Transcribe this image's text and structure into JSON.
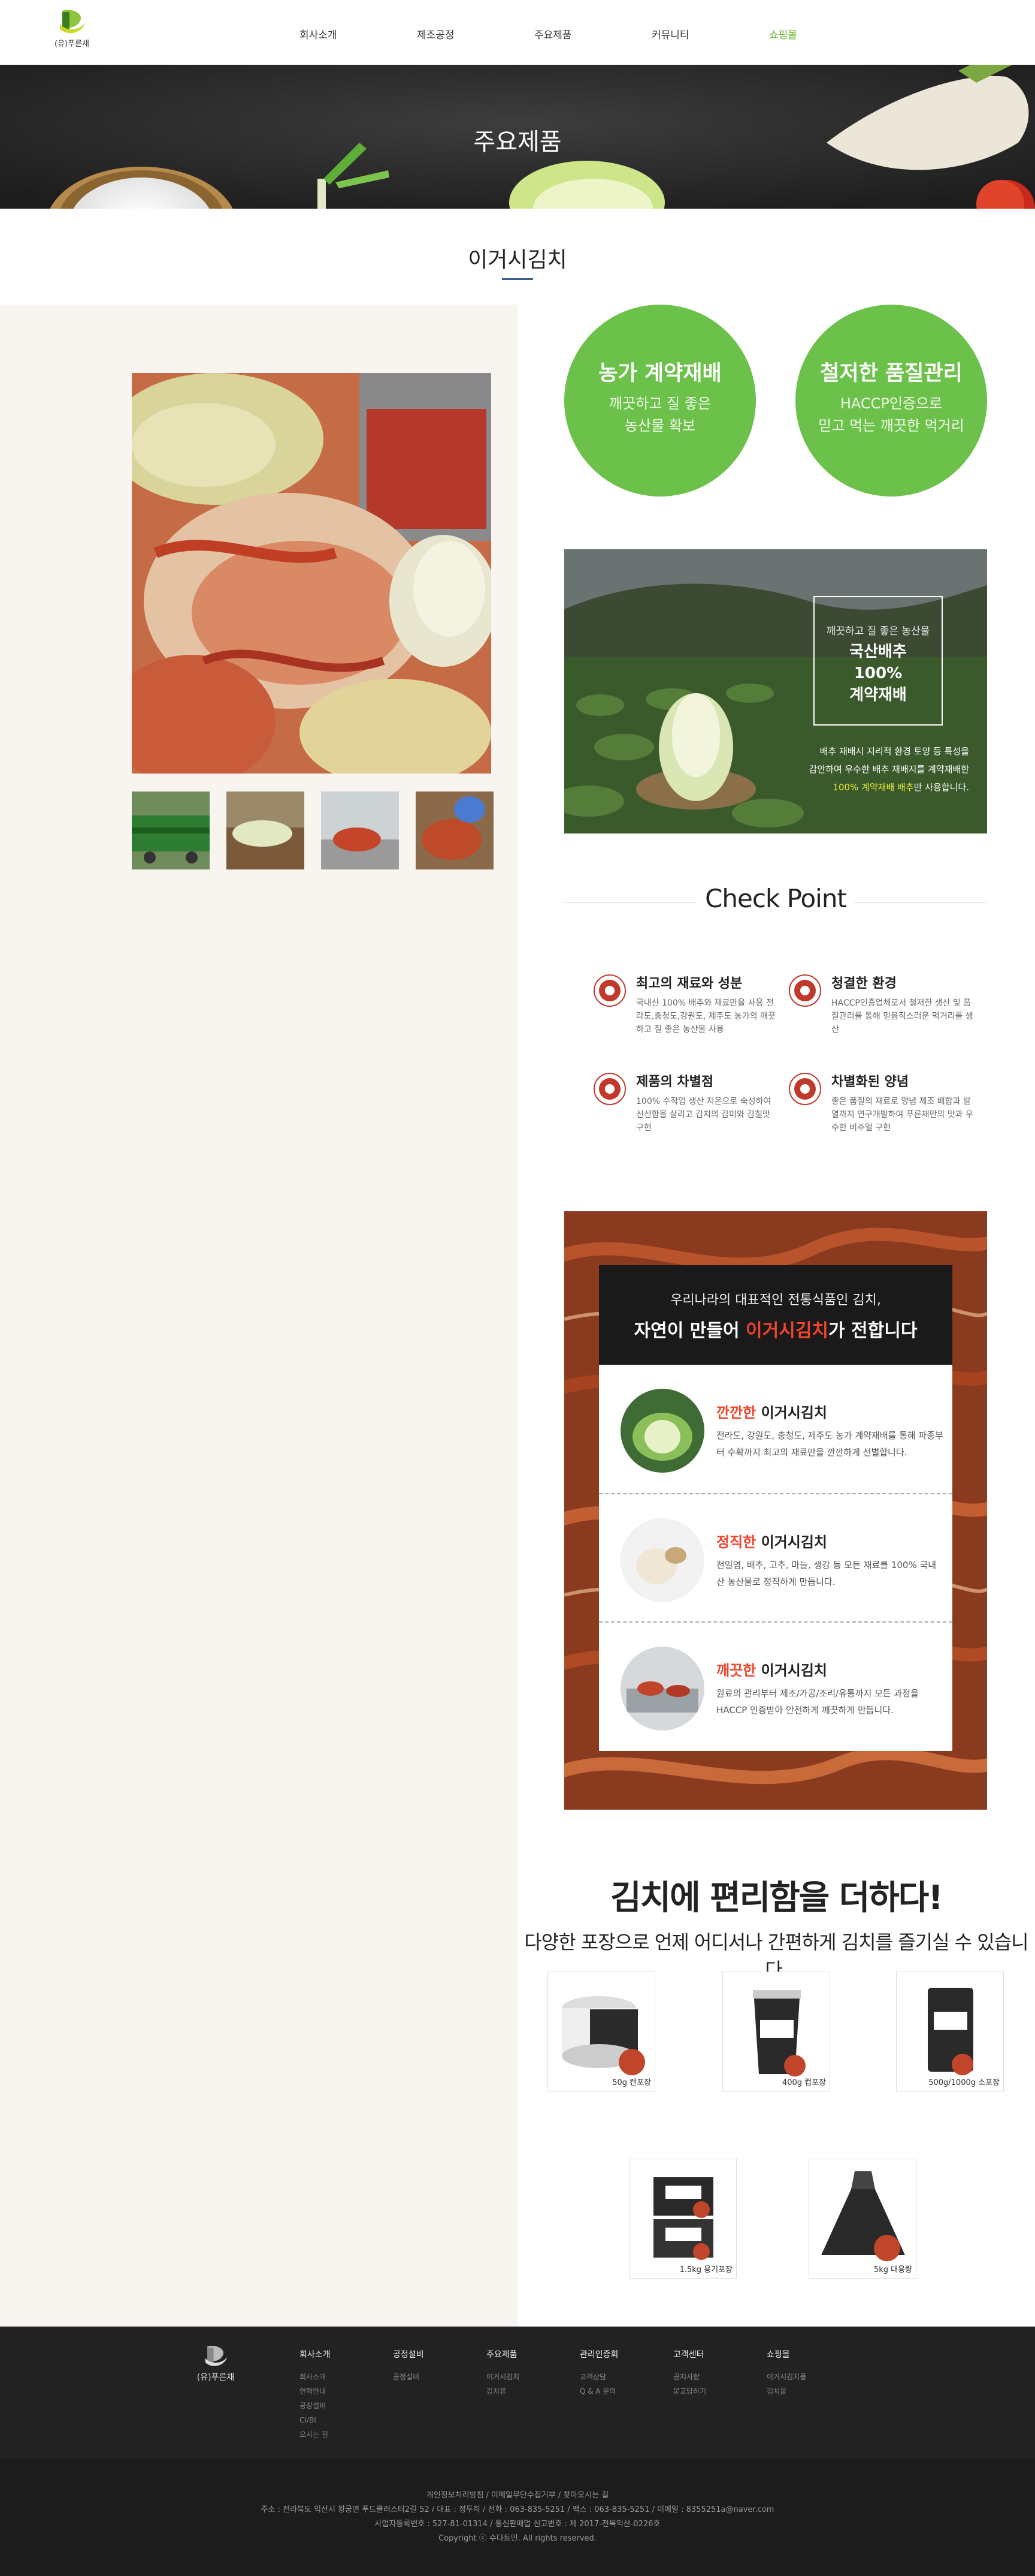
{
  "header": {
    "logo_text": "(유)푸른채",
    "nav": [
      {
        "label": "회사소개",
        "active": false
      },
      {
        "label": "제조공정",
        "active": false
      },
      {
        "label": "주요제품",
        "active": false
      },
      {
        "label": "커뮤니티",
        "active": false
      },
      {
        "label": "쇼핑몰",
        "active": true
      }
    ]
  },
  "banner": {
    "title": "주요제품"
  },
  "page": {
    "subtitle": "이거시김치"
  },
  "colors": {
    "accent": "#67b22a",
    "circle": "#6cc14a",
    "highlight": "#f0442c"
  },
  "features": [
    {
      "title": "농가 계약재배",
      "lines": [
        "깨끗하고 질 좋은",
        "농산물 확보"
      ]
    },
    {
      "title": "철저한 품질관리",
      "lines": [
        "HACCP인증으로",
        "믿고 먹는 깨끗한 먹거리"
      ]
    }
  ],
  "field": {
    "box_small": "깨끗하고 질 좋은 농산물",
    "box_lines": [
      "국산배추",
      "100%",
      "계약재배"
    ],
    "caption_lines": [
      "배추 재배시 지리적 환경 토양 등 특성을",
      "감안하여 우수한 배추 재배지를 계약재배한"
    ],
    "caption_highlight": "100% 계약재배 배추",
    "caption_tail": "만 사용합니다."
  },
  "check_point": {
    "title": "Check Point",
    "items": [
      {
        "title": "최고의 재료와 성분",
        "text": "국내산 100% 배추와 재료만을 사용 전라도,충청도,강원도, 제주도 농가의 깨끗하고 질 좋은 농산물 사용"
      },
      {
        "title": "청결한 환경",
        "text": "HACCP인증업체로서 철저한 생산 및 품질관리를 통해 믿음직스러운 먹거리를 생산"
      },
      {
        "title": "제품의 차별점",
        "text": "100% 수작업 생산 저온으로 숙성하여 신선함을 살리고 김치의 감미와 감칠맛 구현"
      },
      {
        "title": "차별화된 양념",
        "text": "좋은 품질의 재료로 양념 제조 배합과 발열까지 연구개발하여 푸른채만의 맛과 우수한 비주얼 구현"
      }
    ]
  },
  "kimchi_box": {
    "line1": "우리나라의 대표적인 전통식품인 김치,",
    "line2_pre": "자연이 만들어 ",
    "line2_hl": "이거시김치",
    "line2_post": "가 전합니다",
    "rows": [
      {
        "hl": "깐깐한",
        "title": " 이거시김치",
        "desc": "전라도, 강원도, 충청도, 제주도 농가 계약재배를 통해 파종부터 수확까지 최고의 재료만을 깐깐하게 선별합니다."
      },
      {
        "hl": "정직한",
        "title": " 이거시김치",
        "desc": "천일염, 배추, 고추, 마늘, 생강 등 모든 재료를 100% 국내산 농산물로 정직하게 만듭니다."
      },
      {
        "hl": "깨끗한",
        "title": " 이거시김치",
        "desc": "원료의 관리부터 제조/가공/조리/유통까지 모든 과정을 HACCP 인증받아 안전하게 깨끗하게 만듭니다."
      }
    ]
  },
  "convenience": {
    "title": "김치에 편리함을 더하다!",
    "subtitle": "다양한 포장으로 언제 어디서나 간편하게 김치를 즐기실 수 있습니다.",
    "products": [
      {
        "label": "50g 캔포장"
      },
      {
        "label": "400g 컵포장"
      },
      {
        "label": "500g/1000g 소포장"
      },
      {
        "label": "1.5kg 용기포장"
      },
      {
        "label": "5kg 대용량"
      }
    ]
  },
  "footer": {
    "logo_text": "(유)푸른채",
    "columns": [
      {
        "title": "회사소개",
        "items": [
          "회사소개",
          "연혁안내",
          "공장설비",
          "CI/BI",
          "오시는 길"
        ]
      },
      {
        "title": "공정설비",
        "items": [
          "공정설비"
        ]
      },
      {
        "title": "주요제품",
        "items": [
          "이거시김치",
          "김치류"
        ]
      },
      {
        "title": "관리인증회",
        "items": [
          "고객상담",
          "Q & A 문의"
        ]
      },
      {
        "title": "고객센터",
        "items": [
          "공지사항",
          "묻고답하기"
        ]
      },
      {
        "title": "쇼핑몰",
        "items": [
          "이거시김치몰",
          "김치몰"
        ]
      }
    ],
    "links": "개인정보처리방침   /   이메일무단수집거부   /   찾아오시는 길",
    "address": "주소 : 전라북도 익산시 왕궁면 푸드클러스터2길 52   /   대표 : 정두희   /   전화 : 063-835-5251   /   팩스 : 063-835-5251   /   이메일 : 8355251a@naver.com",
    "biz": "사업자등록번호 : 527-81-01314   /   통신판매업 신고번호 : 제 2017-전북익산-0226호",
    "copyright": "Copyright ⓒ 수다트민. All rights reserved."
  }
}
